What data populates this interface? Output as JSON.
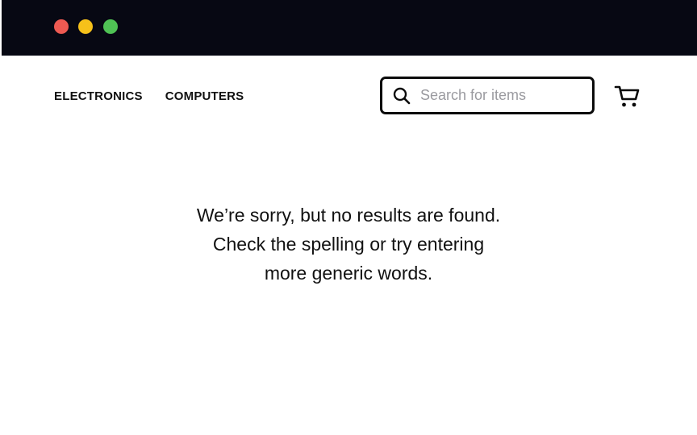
{
  "window": {
    "controls": [
      {
        "name": "close",
        "color": "#ee5a52"
      },
      {
        "name": "minimize",
        "color": "#f6c11a"
      },
      {
        "name": "maximize",
        "color": "#4fc254"
      }
    ],
    "bar_color": "#070813"
  },
  "nav": {
    "items": [
      {
        "label": "ELECTRONICS"
      },
      {
        "label": "COMPUTERS"
      }
    ]
  },
  "search": {
    "placeholder": "Search for items",
    "value": "",
    "icon": "search-icon"
  },
  "cart": {
    "icon": "cart-icon"
  },
  "empty_state": {
    "lines": [
      "We’re sorry, but no results are found.",
      "Check the spelling or try entering",
      "more generic words."
    ]
  }
}
